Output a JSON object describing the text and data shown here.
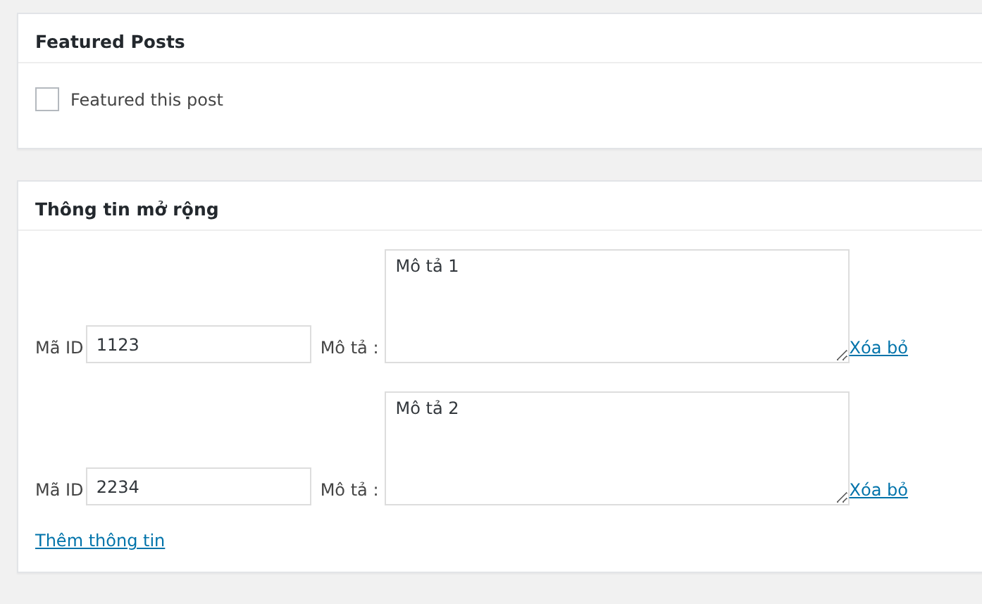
{
  "featured_panel": {
    "title": "Featured Posts",
    "checkbox": {
      "label": "Featured this post",
      "checked": false
    }
  },
  "extra_panel": {
    "title": "Thông tin mở rộng",
    "rows": [
      {
        "id_label": "Mã ID",
        "id_value": "1123",
        "desc_label": "Mô tả :",
        "desc_value": "Mô tả 1",
        "remove_link": "Xóa bỏ"
      },
      {
        "id_label": "Mã ID",
        "id_value": "2234",
        "desc_label": "Mô tả :",
        "desc_value": "Mô tả 2",
        "remove_link": "Xóa bỏ"
      }
    ],
    "add_link": "Thêm thông tin"
  }
}
